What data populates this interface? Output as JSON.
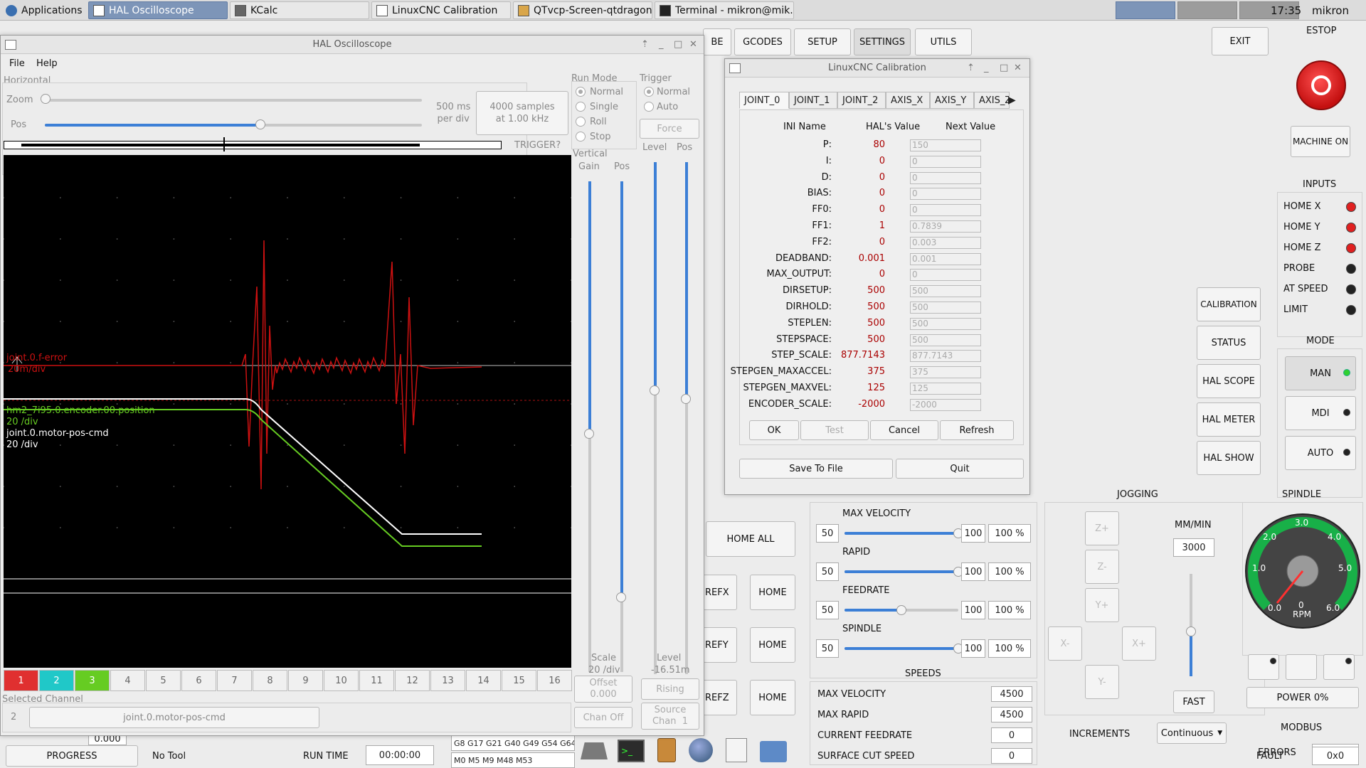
{
  "taskbar": {
    "items": [
      "Applications",
      "HAL Oscilloscope",
      "KCalc",
      "LinuxCNC Calibration",
      "QTvcp-Screen-qtdragon...",
      "Terminal - mikron@mik..."
    ],
    "clock": "17:35",
    "user": "mikron"
  },
  "main": {
    "topbar": [
      "BE",
      "GCODES",
      "SETUP",
      "SETTINGS",
      "UTILS"
    ],
    "exit": "EXIT",
    "estop": {
      "title": "ESTOP",
      "machine_on": "MACHINE ON"
    },
    "inputs": {
      "title": "INPUTS",
      "items": [
        "HOME X",
        "HOME Y",
        "HOME Z",
        "PROBE",
        "AT SPEED",
        "LIMIT"
      ]
    },
    "mode": {
      "title": "MODE",
      "items": [
        "MAN",
        "MDI",
        "AUTO"
      ]
    },
    "side_buttons": [
      "CALIBRATION",
      "STATUS",
      "HAL SCOPE",
      "HAL METER",
      "HAL SHOW"
    ],
    "home_all": "HOME ALL",
    "ref_buttons": [
      "REFX",
      "REFY",
      "REFZ"
    ],
    "home": "HOME",
    "overrides": {
      "items": [
        {
          "label": "MAX VELOCITY",
          "min": "50",
          "max": "100",
          "pct": "100 %",
          "level": 1.0
        },
        {
          "label": "RAPID",
          "min": "50",
          "max": "100",
          "pct": "100 %",
          "level": 1.0
        },
        {
          "label": "FEEDRATE",
          "min": "50",
          "max": "100",
          "pct": "100 %",
          "level": 0.5
        },
        {
          "label": "SPINDLE",
          "min": "50",
          "max": "100",
          "pct": "100 %",
          "level": 1.0
        }
      ]
    },
    "speeds": {
      "title": "SPEEDS",
      "items": [
        {
          "label": "MAX VELOCITY",
          "value": "4500"
        },
        {
          "label": "MAX RAPID",
          "value": "4500"
        },
        {
          "label": "CURRENT FEEDRATE",
          "value": "0"
        },
        {
          "label": "SURFACE CUT SPEED",
          "value": "0"
        }
      ]
    },
    "jogging": {
      "title": "JOGGING",
      "units": "MM/MIN",
      "rate": "3000",
      "fast": "FAST",
      "increments_label": "INCREMENTS",
      "increments": "Continuous",
      "keys": [
        "Z+",
        "Z-",
        "Y+",
        "X-",
        "X+",
        "Y-"
      ]
    },
    "spindle": {
      "title": "SPINDLE",
      "power": "POWER 0%",
      "ticks": [
        "0.0",
        "1.0",
        "2.0",
        "3.0",
        "4.0",
        "5.0",
        "6.0"
      ],
      "unit": "RPM",
      "zero": "0"
    },
    "modbus": {
      "title": "MODBUS",
      "errors_label": "ERRORS",
      "errors": "0",
      "fault_label": "FAULT",
      "fault": "0x0"
    },
    "status": {
      "progress": "PROGRESS",
      "tool": "No Tool",
      "run_time_label": "RUN TIME",
      "run_time": "00:00:00",
      "gcodes": "G8 G17 G21 G40 G49 G54 G64",
      "mcodes": "M0 M5 M9 M48 M53",
      "offset_val": "0.000"
    }
  },
  "scope": {
    "title": "HAL Oscilloscope",
    "menu": [
      "File",
      "Help"
    ],
    "horizontal": "Horizontal",
    "zoom": "Zoom",
    "pos": "Pos",
    "rate": "500 ms\nper div",
    "samples": "4000 samples\nat 1.00 kHz",
    "trigger_q": "TRIGGER?",
    "run_mode": {
      "title": "Run Mode",
      "options": [
        "Normal",
        "Single",
        "Roll",
        "Stop"
      ]
    },
    "trigger": {
      "title": "Trigger",
      "options": [
        "Normal",
        "Auto"
      ],
      "force": "Force",
      "level": "Level",
      "pos": "Pos"
    },
    "vertical": {
      "title": "Vertical",
      "gain": "Gain",
      "pos": "Pos"
    },
    "traces": [
      {
        "label": "joint.0.f-error",
        "scale": "20m/div",
        "color": "#cc1111"
      },
      {
        "label": "hm2_7i95.0.encoder.00.position",
        "scale": "20 /div",
        "color": "#66cc22"
      },
      {
        "label": "joint.0.motor-pos-cmd",
        "scale": "20 /div",
        "color": "#ffffff"
      }
    ],
    "channels": [
      "1",
      "2",
      "3",
      "4",
      "5",
      "6",
      "7",
      "8",
      "9",
      "10",
      "11",
      "12",
      "13",
      "14",
      "15",
      "16"
    ],
    "channel_colors": [
      "#e03030",
      "#20c8c8",
      "#66cc22"
    ],
    "scale_label": "Scale",
    "scale_val": "20 /div",
    "offset_label": "Offset",
    "offset_val": "0.000",
    "chan_off": "Chan Off",
    "level_label": "Level",
    "level_val": "-16.51m",
    "rising": "Rising",
    "source": "Source\nChan  1",
    "selected_channel": "Selected Channel",
    "sel_num": "2",
    "sel_name": "joint.0.motor-pos-cmd"
  },
  "calib": {
    "title": "LinuxCNC Calibration",
    "tabs": [
      "JOINT_0",
      "JOINT_1",
      "JOINT_2",
      "AXIS_X",
      "AXIS_Y",
      "AXIS_Z"
    ],
    "headers": [
      "INI Name",
      "HAL's Value",
      "Next Value"
    ],
    "rows": [
      {
        "name": "P:",
        "hal": "80",
        "next": "150"
      },
      {
        "name": "I:",
        "hal": "0",
        "next": "0"
      },
      {
        "name": "D:",
        "hal": "0",
        "next": "0"
      },
      {
        "name": "BIAS:",
        "hal": "0",
        "next": "0"
      },
      {
        "name": "FF0:",
        "hal": "0",
        "next": "0"
      },
      {
        "name": "FF1:",
        "hal": "1",
        "next": "0.7839"
      },
      {
        "name": "FF2:",
        "hal": "0",
        "next": "0.003"
      },
      {
        "name": "DEADBAND:",
        "hal": "0.001",
        "next": "0.001"
      },
      {
        "name": "MAX_OUTPUT:",
        "hal": "0",
        "next": "0"
      },
      {
        "name": "DIRSETUP:",
        "hal": "500",
        "next": "500"
      },
      {
        "name": "DIRHOLD:",
        "hal": "500",
        "next": "500"
      },
      {
        "name": "STEPLEN:",
        "hal": "500",
        "next": "500"
      },
      {
        "name": "STEPSPACE:",
        "hal": "500",
        "next": "500"
      },
      {
        "name": "STEP_SCALE:",
        "hal": "877.7143",
        "next": "877.7143"
      },
      {
        "name": "STEPGEN_MAXACCEL:",
        "hal": "375",
        "next": "375"
      },
      {
        "name": "STEPGEN_MAXVEL:",
        "hal": "125",
        "next": "125"
      },
      {
        "name": "ENCODER_SCALE:",
        "hal": "-2000",
        "next": "-2000"
      }
    ],
    "buttons": [
      "OK",
      "Test",
      "Cancel",
      "Refresh"
    ],
    "save": "Save To File",
    "quit": "Quit"
  }
}
